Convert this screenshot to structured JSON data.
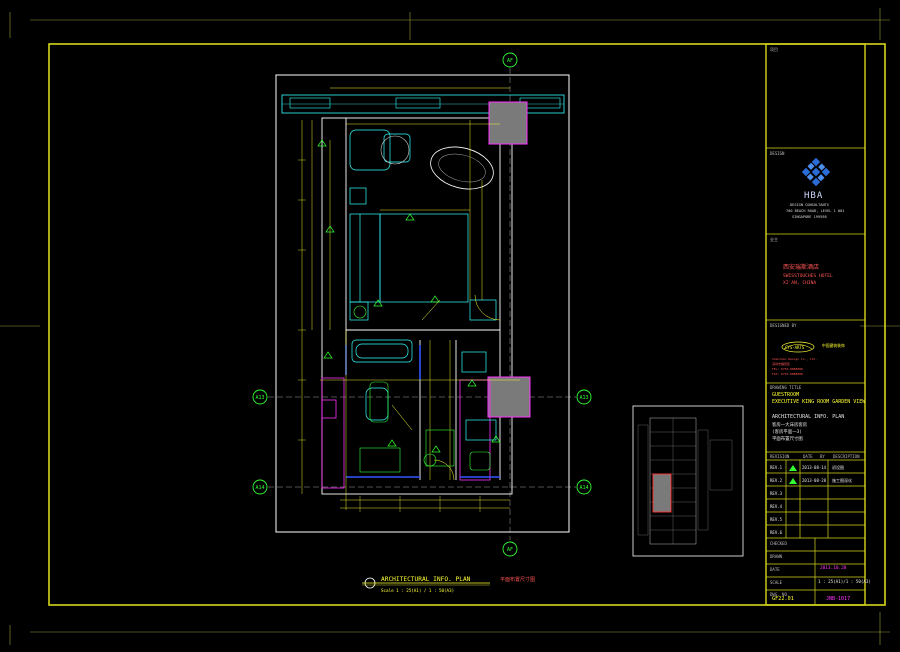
{
  "grid_labels": {
    "af_top": "AF",
    "af_bottom": "AF",
    "a13_left": "A13",
    "a13_right": "A13",
    "a14_left": "A14",
    "a14_right": "A14"
  },
  "plan_caption": {
    "title": "ARCHITECTURAL INFO. PLAN",
    "chinese_title": "平面布置尺寸图",
    "scale": "Scale 1 : 25(A1) / 1 : 50(A3)"
  },
  "title_block": {
    "project_label": "项目",
    "design_label": "DESIGN",
    "hba_word": "HBA",
    "hba_line1": "DESIGN CONSULTANTS",
    "hba_line2": "700 BEACH ROAD, LEVEL 1 #01",
    "hba_line3": "SINGAPORE 199598",
    "client_label": "业主",
    "hotel_cn": "西安瑞斯酒店",
    "hotel_en": "SWISSTOUCHES HOTEL",
    "city": "XI'AN, CHINA",
    "operator_label": "DESIGNED BY",
    "company_name": "CYS-ARTS",
    "company_sub": "中国建筑装饰",
    "company_lines": [
      "Shenzhen Design Co., Ltd.",
      "深圳市福田区",
      "TEL: 0755-8888888",
      "FAX: 0755-8888888"
    ],
    "drawing_label": "DRAWING TITLE",
    "room_type": "GUESTROOM",
    "room_name": "EXECUTIVE KING ROOM GARDEN VIEW",
    "plan_title": "ARCHITECTURAL INFO. PLAN",
    "plan_title_cn1": "客房一大床房客房",
    "plan_title_cn2": "(客房平面一3)",
    "plan_title_cn3": "平面布置尺寸图",
    "revision_headers": [
      "REVISION",
      "DATE",
      "BY",
      "DESCRIPTION"
    ],
    "revisions": [
      {
        "no": "REV.1",
        "date": "2013-08-14",
        "desc": "初设图"
      },
      {
        "no": "REV.2",
        "date": "2013-08-28",
        "desc": "施工图深化"
      },
      {
        "no": "REV.3",
        "date": "",
        "desc": ""
      },
      {
        "no": "REV.4",
        "date": "",
        "desc": ""
      },
      {
        "no": "REV.5",
        "date": "",
        "desc": ""
      },
      {
        "no": "REV.6",
        "date": "",
        "desc": ""
      }
    ],
    "checked_label": "CHECKED",
    "drawn_label": "DRAWN",
    "date_label": "DATE",
    "date_value": "2013.10.28",
    "scale_label": "SCALE",
    "scale_value": "1 : 25(A1)/1 : 50(A3)",
    "dwg_no_label": "DWG. NO.",
    "dwg_no": "GF22.01",
    "job_no": "JNB-1017"
  },
  "colors": {
    "frame": "#d6d61c",
    "walls": "#ffffff",
    "cyan": "#33ffff",
    "green": "#33ff33",
    "magenta": "#ff33ff",
    "blue": "#3355ff",
    "yellow": "#ffff33",
    "gray_fill": "#7a7a7a"
  }
}
